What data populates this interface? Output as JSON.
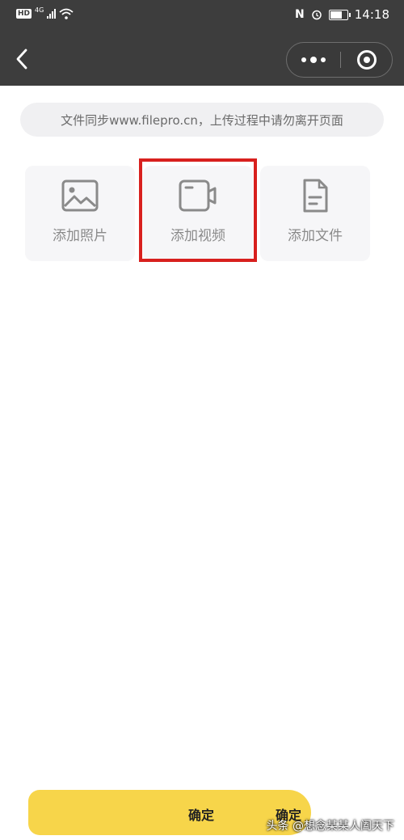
{
  "status_bar": {
    "hd": "HD",
    "network": "4G",
    "time": "14:18"
  },
  "nav": {
    "back_icon": "chevron-left-icon",
    "more_icon": "more-dots-icon",
    "close_icon": "target-circle-icon"
  },
  "notice": "文件同步www.filepro.cn，上传过程中请勿离开页面",
  "tiles": [
    {
      "label": "添加照片",
      "icon": "image-icon"
    },
    {
      "label": "添加视频",
      "icon": "video-icon"
    },
    {
      "label": "添加文件",
      "icon": "file-icon"
    }
  ],
  "confirm": {
    "label": "确定",
    "label_duplicate": "确定"
  },
  "watermark": "头条 @想念某某人阖天下",
  "colors": {
    "header_bg": "#3d3d3d",
    "button_bg": "#f7d54a",
    "highlight": "#d8201e",
    "tile_bg": "#f6f6f8"
  }
}
